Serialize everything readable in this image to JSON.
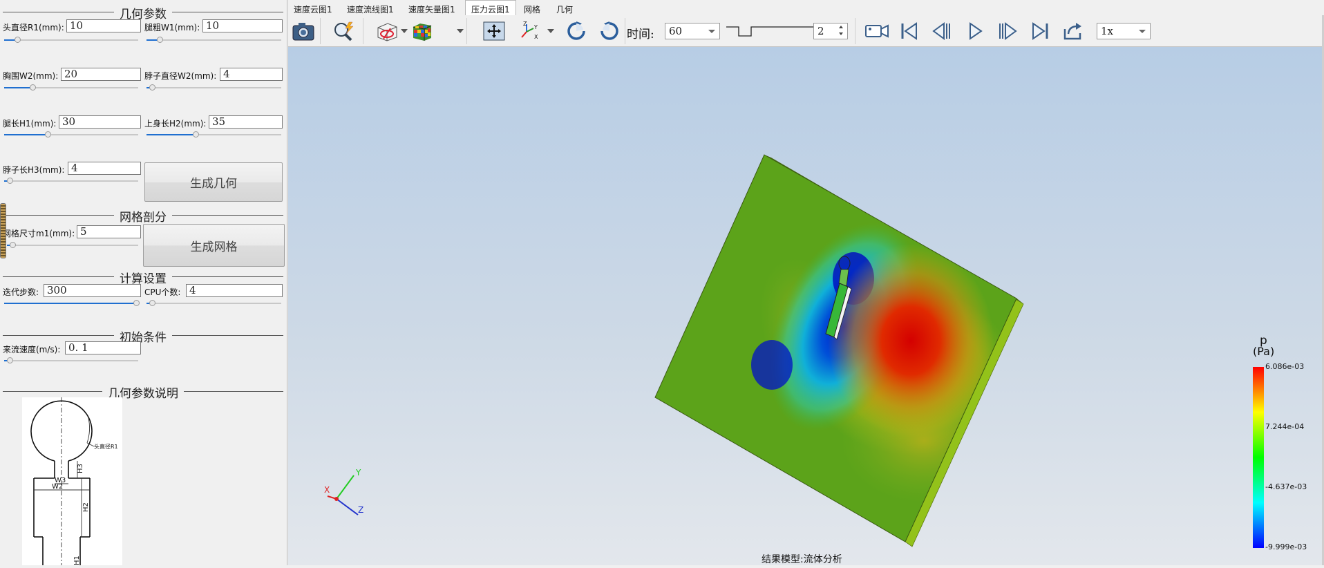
{
  "left_panel": {
    "geometry": {
      "title": "几何参数",
      "head_diameter": {
        "label": "头直径R1(mm):",
        "value": "10",
        "slider": 0.08
      },
      "waist_w1": {
        "label": "腿粗W1(mm):",
        "value": "10",
        "slider": 0.08
      },
      "chest_w2": {
        "label": "胸围W2(mm):",
        "value": "20",
        "slider": 0.2
      },
      "neck_w2": {
        "label": "脖子直径W2(mm):",
        "value": "4",
        "slider": 0.02
      },
      "leg_h1": {
        "label": "腿长H1(mm):",
        "value": "30",
        "slider": 0.32
      },
      "upper_h2": {
        "label": "上身长H2(mm):",
        "value": "35",
        "slider": 0.36
      },
      "neck_h3": {
        "label": "脖子长H3(mm):",
        "value": "4",
        "slider": 0.02
      },
      "generate_button": "生成几何"
    },
    "mesh": {
      "title": "网格剖分",
      "size": {
        "label": "网格尺寸m1(mm):",
        "value": "5",
        "slider": 0.02
      },
      "generate_button": "生成网格"
    },
    "compute": {
      "title": "计算设置",
      "iterations": {
        "label": "迭代步数:",
        "value": "300",
        "slider": 1.0
      },
      "cpu": {
        "label": "CPU个数:",
        "value": "4",
        "slider": 0.02
      }
    },
    "initial": {
      "title": "初始条件",
      "inflow": {
        "label": "来流速度(m/s):",
        "value": "0. 1",
        "slider": 0.02
      }
    },
    "explain": {
      "title": "几何参数说明",
      "diagram_labels": {
        "r1": "头直径R1",
        "h3": "H3",
        "w3": "W3",
        "w2": "W2",
        "h2": "H2",
        "h1": "H1"
      }
    }
  },
  "tabs": [
    {
      "label": "速度云图1",
      "active": false
    },
    {
      "label": "速度流线图1",
      "active": false
    },
    {
      "label": "速度矢量图1",
      "active": false
    },
    {
      "label": "压力云图1",
      "active": true
    },
    {
      "label": "网格",
      "active": false
    },
    {
      "label": "几何",
      "active": false
    }
  ],
  "toolbar": {
    "time_label": "时间:",
    "time_value": "60",
    "step_value": "2",
    "speed_value": "1x"
  },
  "viewport": {
    "caption": "结果模型:流体分析",
    "axes": {
      "x": "X",
      "y": "Y",
      "z": "Z"
    },
    "legend": {
      "variable": "p",
      "unit": "(Pa)",
      "ticks": [
        "6.086e-03",
        "7.244e-04",
        "-4.637e-03",
        "-9.999e-03"
      ],
      "colors": [
        "#ff0000",
        "#ffff00",
        "#00ff00",
        "#00ffff",
        "#0000ff"
      ]
    }
  }
}
